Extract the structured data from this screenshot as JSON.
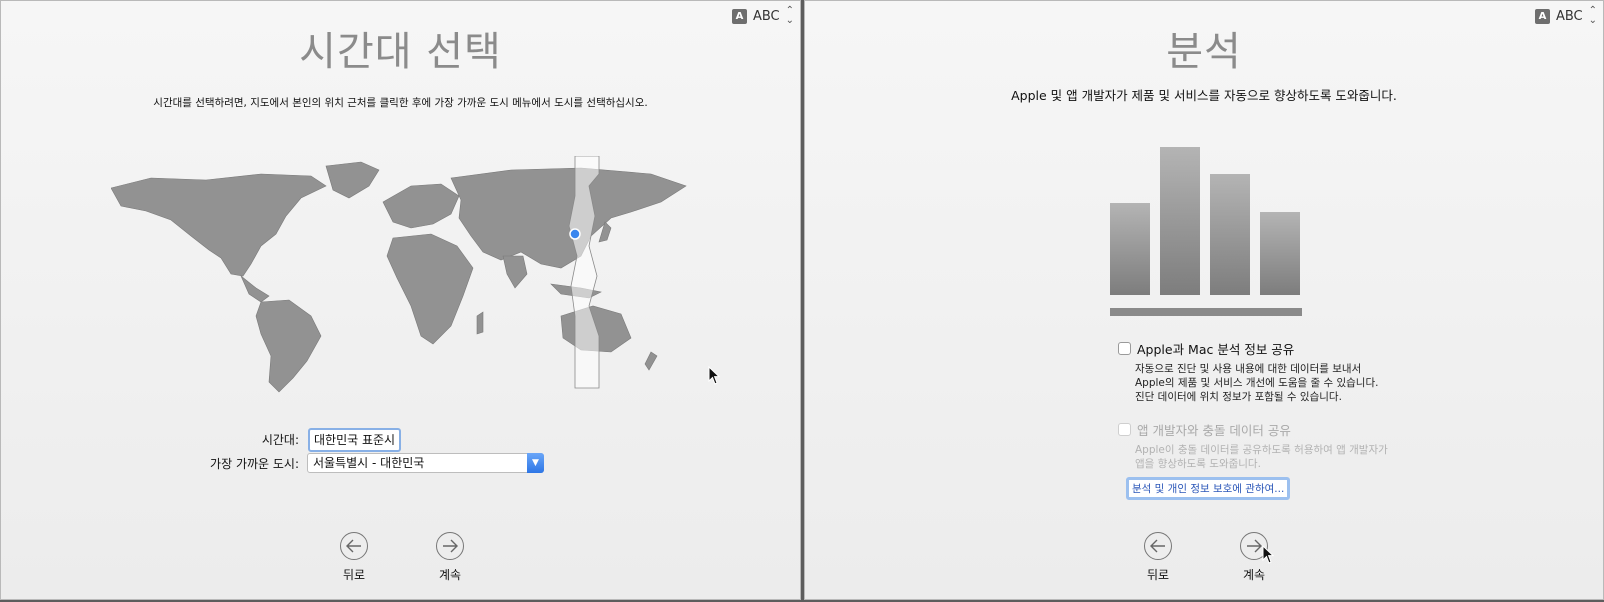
{
  "input_menu": {
    "badge": "A",
    "label": "ABC"
  },
  "timezone_pane": {
    "title": "시간대 선택",
    "description": "시간대를 선택하려면, 지도에서 본인의 위치 근처를 클릭한 후에 가장 가까운 도시 메뉴에서 도시를 선택하십시오.",
    "timezone_label": "시간대:",
    "timezone_value": "대한민국 표준시",
    "city_label": "가장 가까운 도시:",
    "city_value": "서울특별시 - 대한민국",
    "back_label": "뒤로",
    "continue_label": "계속"
  },
  "analytics_pane": {
    "title": "분석",
    "description": "Apple 및 앱 개발자가 제품 및 서비스를 자동으로 향상하도록 도와줍니다.",
    "chart_bar_levels": [
      0.62,
      1.0,
      0.82,
      0.56
    ],
    "share_mac_label": "Apple과 Mac 분석 정보 공유",
    "share_mac_desc": [
      "자동으로 진단 및 사용 내용에 대한 데이터를 보내서",
      "Apple의 제품 및 서비스 개선에 도움을 줄 수 있습니다.",
      "진단 데이터에 위치 정보가 포함될 수 있습니다."
    ],
    "share_crash_label": "앱 개발자와 충돌 데이터 공유",
    "share_crash_desc": [
      "Apple이 충돌 데이터를 공유하도록 허용하여 앱 개발자가",
      "앱을 향상하도록 도와줍니다."
    ],
    "about_link": "분석 및 개인 정보 보호에 관하여...",
    "back_label": "뒤로",
    "continue_label": "계속"
  },
  "colors": {
    "bar_top": "#b4b4b4",
    "bar_bottom": "#7d7d7d",
    "map_land": "#8f8f8f",
    "accent_blue": "#2d76e6"
  },
  "icons": [
    "arrow-left-icon",
    "arrow-right-icon",
    "mouse-cursor-icon",
    "chevron-down-icon",
    "location-pin-icon"
  ]
}
